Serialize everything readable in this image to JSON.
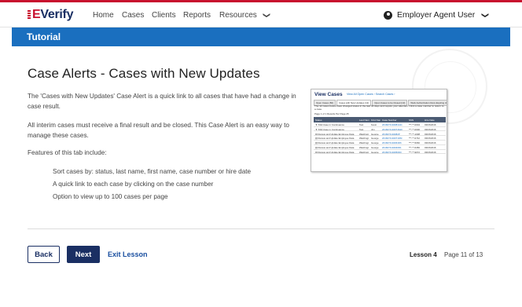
{
  "nav": {
    "logo_e": "E",
    "logo_verify": "Verify",
    "items": [
      "Home",
      "Cases",
      "Clients",
      "Reports",
      "Resources"
    ],
    "resources_chevron": "❯",
    "user": "Employer Agent User"
  },
  "banner": {
    "title": "Tutorial"
  },
  "content": {
    "heading": "Case Alerts - Cases with New Updates",
    "para1": "The 'Cases with New Updates' Case Alert is a quick link to all cases that have had a change in case result.",
    "para2": "All interim cases must receive a final result and be closed. This Case Alert is an easy way to manage these cases.",
    "para3": "Features of this tab include:",
    "features": [
      "Sort cases by: status, last name, first name, case number or hire date",
      "A quick link to each case by clicking on the case number",
      "Option to view up to 100 cases per page"
    ]
  },
  "screenshot": {
    "title": "View Cases",
    "links": "View All Open Cases ›   Search Cases ›",
    "tabs": [
      "Open Cases (50)",
      "Cases with New Updates (12)",
      "Open Cases to be Closed (13)",
      "Work Authorization Docs Expiring (0)"
    ],
    "message": "The 12 cases below have changed status in the last 30 days and require your attention. Click a case number to return to a case.",
    "controls": "Page 1 of 1     Results Per Page  25",
    "headers": [
      "Status",
      "Last Name",
      "First Name",
      "Case Number",
      "SSN",
      "Hire Date"
    ],
    "rows": [
      {
        "status": "SSA Case in Continuance",
        "last": "Test",
        "first": "Kevin",
        "case": "2016074104081441",
        "ssn": "***-**-0004",
        "hire": "03/15/2016",
        "warn": true
      },
      {
        "status": "SSA Case in Continuance",
        "last": "Test",
        "first": "Jim",
        "case": "2016074104074640",
        "ssn": "***-**-0000",
        "hire": "03/15/2016",
        "warn": true
      },
      {
        "status": "Review and Update Employee Data",
        "last": "Washingt...",
        "first": "George",
        "case": "2016074104082P",
        "ssn": "***-**-1038",
        "hire": "03/15/2016",
        "warn": false
      },
      {
        "status": "Review and Update Employee Data",
        "last": "Washingt...",
        "first": "George",
        "case": "2016074104071DM",
        "ssn": "***-**-0742",
        "hire": "03/15/2016",
        "warn": false
      },
      {
        "status": "Review and Update Employee Data",
        "last": "Washingt...",
        "first": "George",
        "case": "2016074104064D6",
        "ssn": "***-**-5060",
        "hire": "03/15/2016",
        "warn": false
      },
      {
        "status": "Review and Update Employee Data",
        "last": "Washingt...",
        "first": "George",
        "case": "2016074104040D1",
        "ssn": "***-**-6450",
        "hire": "03/15/2016",
        "warn": false
      },
      {
        "status": "Review and Update Employee Data",
        "last": "Washingt...",
        "first": "George",
        "case": "2016074104050D0",
        "ssn": "***-**-9072",
        "hire": "03/15/2016",
        "warn": false
      }
    ]
  },
  "footer": {
    "back": "Back",
    "next": "Next",
    "exit": "Exit Lesson",
    "lesson": "Lesson 4",
    "page": "Page 11 of 13"
  }
}
